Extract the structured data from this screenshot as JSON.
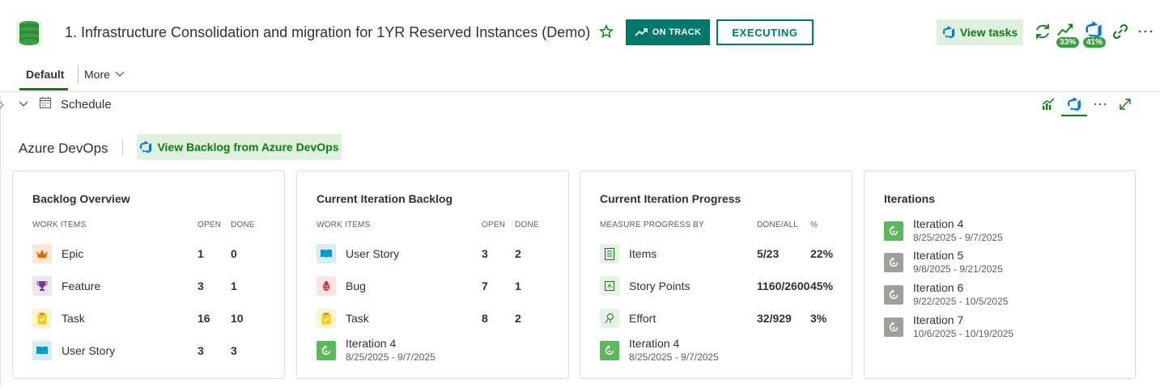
{
  "header": {
    "title": "1. Infrastructure Consolidation and migration for 1YR Reserved Instances (Demo)",
    "status_on_track": "ON TRACK",
    "status_executing": "EXECUTING",
    "view_tasks_label": "View tasks",
    "progress_badge_1": "33%",
    "progress_badge_2": "41%"
  },
  "tabs": {
    "default": "Default",
    "more": "More"
  },
  "section": {
    "title": "Schedule"
  },
  "ado": {
    "label": "Azure DevOps",
    "button_label": "View Backlog from Azure DevOps"
  },
  "cards": {
    "backlog_overview": {
      "title": "Backlog Overview",
      "col_items": "WORK ITEMS",
      "col_open": "OPEN",
      "col_done": "DONE",
      "rows": [
        {
          "label": "Epic",
          "open": "1",
          "done": "0"
        },
        {
          "label": "Feature",
          "open": "3",
          "done": "1"
        },
        {
          "label": "Task",
          "open": "16",
          "done": "10"
        },
        {
          "label": "User Story",
          "open": "3",
          "done": "3"
        }
      ]
    },
    "iteration_backlog": {
      "title": "Current Iteration Backlog",
      "col_items": "WORK ITEMS",
      "col_open": "OPEN",
      "col_done": "DONE",
      "rows": [
        {
          "label": "User Story",
          "open": "3",
          "done": "2"
        },
        {
          "label": "Bug",
          "open": "7",
          "done": "1"
        },
        {
          "label": "Task",
          "open": "8",
          "done": "2"
        }
      ],
      "iteration": {
        "name": "Iteration 4",
        "dates": "8/25/2025 - 9/7/2025"
      }
    },
    "iteration_progress": {
      "title": "Current Iteration Progress",
      "col_measure": "MEASURE PROGRESS BY",
      "col_done_all": "DONE/ALL",
      "col_pct": "%",
      "rows": [
        {
          "label": "Items",
          "done_all": "5/23",
          "pct": "22%"
        },
        {
          "label": "Story Points",
          "done_all": "1160/2600",
          "pct": "45%"
        },
        {
          "label": "Effort",
          "done_all": "32/929",
          "pct": "3%"
        }
      ],
      "iteration": {
        "name": "Iteration 4",
        "dates": "8/25/2025 - 9/7/2025"
      }
    },
    "iterations": {
      "title": "Iterations",
      "items": [
        {
          "name": "Iteration 4",
          "dates": "8/25/2025 - 9/7/2025"
        },
        {
          "name": "Iteration 5",
          "dates": "9/8/2025 - 9/21/2025"
        },
        {
          "name": "Iteration 6",
          "dates": "9/22/2025 - 10/5/2025"
        },
        {
          "name": "Iteration 7",
          "dates": "10/6/2025 - 10/19/2025"
        }
      ]
    }
  },
  "colors": {
    "accent": "#107c10",
    "status_teal": "#00796b",
    "button_bg": "#dff0df",
    "azure_blue": "#0078d4"
  }
}
